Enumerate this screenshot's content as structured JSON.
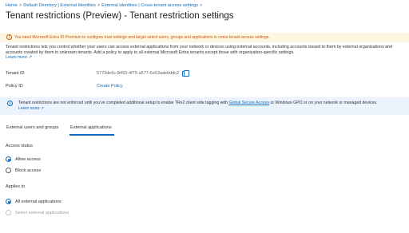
{
  "breadcrumb": [
    {
      "label": "Home"
    },
    {
      "label": "Default Directory | External Identities"
    },
    {
      "label": "External Identities | Cross-tenant access settings"
    }
  ],
  "breadcrumb_separator": ">",
  "page": {
    "title": "Tenant restrictions (Preview) - Tenant restriction settings",
    "more_label": "···"
  },
  "warning": {
    "text": "You need Microsoft Entra ID Premium to configure trust settings and target select users, groups and applications in cross-tenant access settings."
  },
  "description": {
    "text": "Tenant restrictions lets you control whether your users can access external applications from your network or devices using external accounts, including accounts issued to them by external organizations and accounts created by them in unknown tenants. Add a policy to apply to all external Microsoft Entra tenants except those with organization-specific settings.",
    "learn_more": "Learn more"
  },
  "fields": {
    "tenant_id_label": "Tenant ID",
    "tenant_id_value": "5773de6c-8493-4f75-a577-6e63ade0ddc2",
    "policy_id_label": "Policy ID",
    "policy_id_value": "Create Policy"
  },
  "info": {
    "text_before": "Tenant restrictions are not enforced until you've completed additional setup to enable TRv2 client side tagging with ",
    "link": "Global Secure Access",
    "text_after": " or Windows GPO or on your network or managed devices.",
    "learn_more": "Learn more"
  },
  "tabs": [
    {
      "label": "External users and groups",
      "active": false
    },
    {
      "label": "External applications",
      "active": true
    }
  ],
  "access_status": {
    "label": "Access status",
    "options": [
      {
        "label": "Allow access",
        "checked": true
      },
      {
        "label": "Block access",
        "checked": false
      }
    ]
  },
  "applies_to": {
    "label": "Applies to",
    "options": [
      {
        "label": "All external applications",
        "checked": true
      },
      {
        "label": "Select external applications",
        "checked": false
      }
    ]
  },
  "colors": {
    "accent": "#0f6cbd",
    "warning_bg": "#fdf6e3",
    "warning_text": "#c55a11",
    "info_bg": "#ebf3fc"
  },
  "icons": [
    "warning-icon",
    "info-icon",
    "copy-icon",
    "external-link-icon"
  ]
}
